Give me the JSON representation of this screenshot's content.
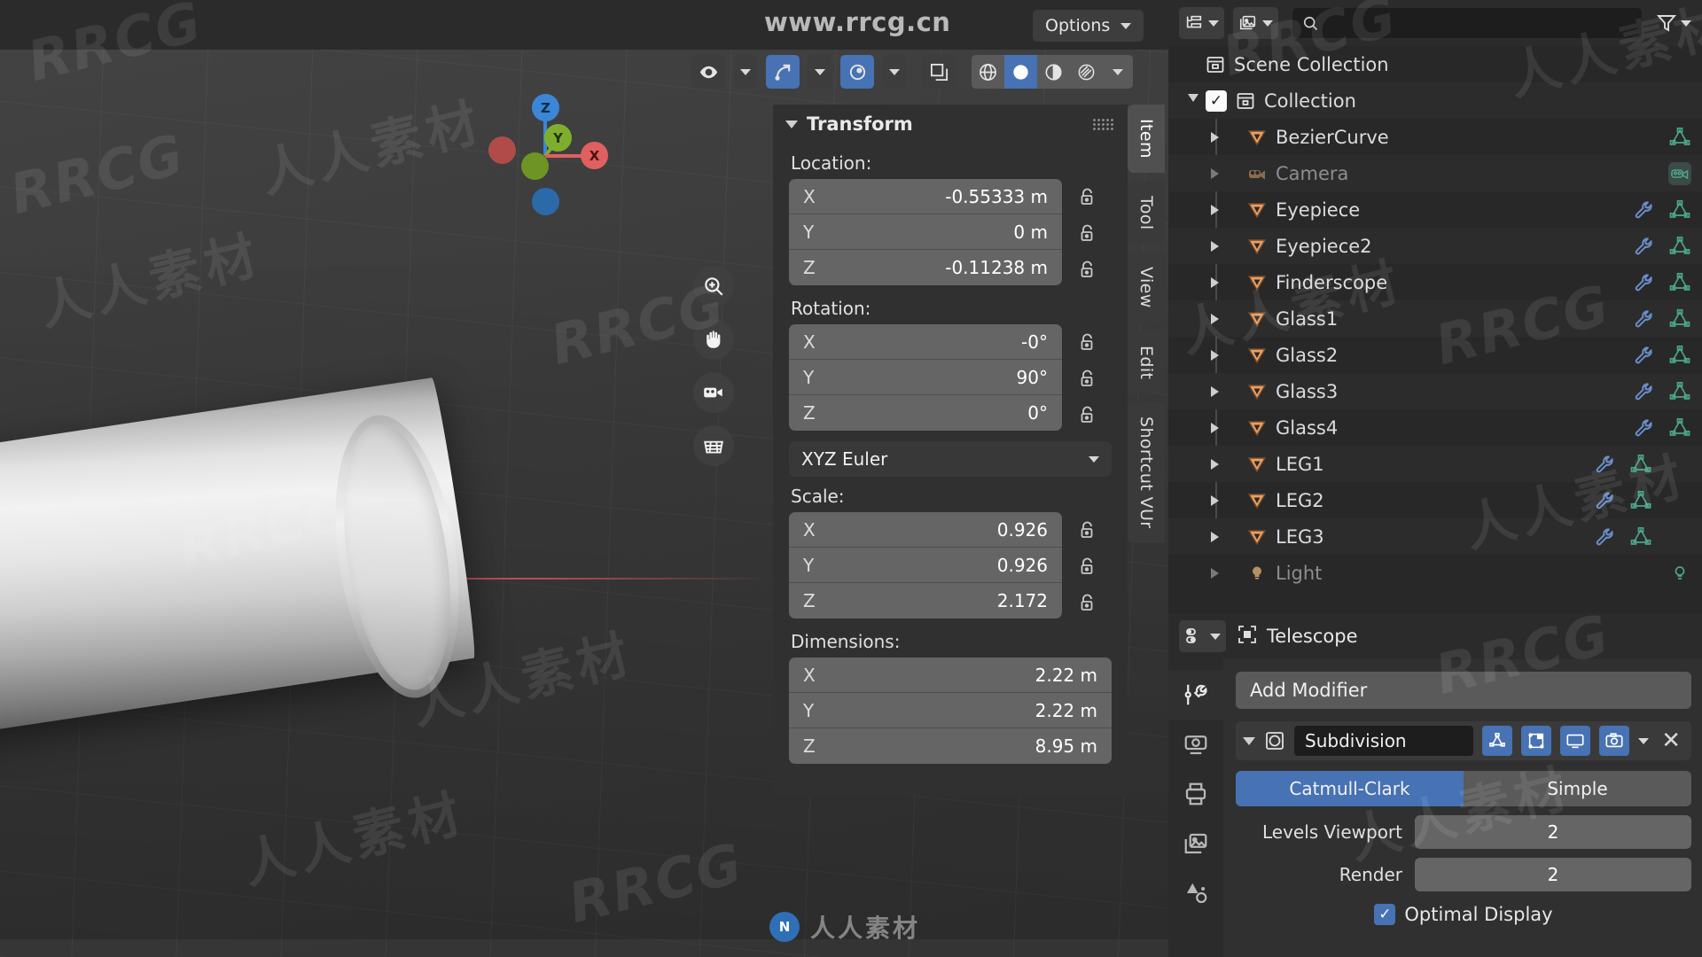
{
  "viewport": {
    "watermark_url": "www.rrcg.cn",
    "options_label": "Options",
    "header_icons": [
      "visibility-icon",
      "snap-magnet-icon",
      "proportional-edit-icon",
      "overlays-icon",
      "xray-icon",
      "wireframe-shading-icon",
      "solid-shading-icon",
      "material-shading-icon",
      "rendered-shading-icon"
    ],
    "gizmo_axes": {
      "x": "X",
      "y": "Y",
      "z": "Z"
    },
    "nav_tools": [
      "zoom-icon",
      "pan-icon",
      "camera-icon",
      "orthographic-icon"
    ]
  },
  "sidebar": {
    "panel_title": "Transform",
    "tabs": [
      {
        "label": "Item",
        "active": true
      },
      {
        "label": "Tool",
        "active": false
      },
      {
        "label": "View",
        "active": false
      },
      {
        "label": "Edit",
        "active": false
      },
      {
        "label": "Shortcut VUr",
        "active": false
      }
    ],
    "location": {
      "label": "Location:",
      "rows": [
        {
          "axis": "X",
          "value": "-0.55333 m"
        },
        {
          "axis": "Y",
          "value": "0 m"
        },
        {
          "axis": "Z",
          "value": "-0.11238 m"
        }
      ]
    },
    "rotation": {
      "label": "Rotation:",
      "rows": [
        {
          "axis": "X",
          "value": "-0°"
        },
        {
          "axis": "Y",
          "value": "90°"
        },
        {
          "axis": "Z",
          "value": "0°"
        }
      ],
      "mode": "XYZ Euler"
    },
    "scale": {
      "label": "Scale:",
      "rows": [
        {
          "axis": "X",
          "value": "0.926"
        },
        {
          "axis": "Y",
          "value": "0.926"
        },
        {
          "axis": "Z",
          "value": "2.172"
        }
      ]
    },
    "dimensions": {
      "label": "Dimensions:",
      "rows": [
        {
          "axis": "X",
          "value": "2.22 m"
        },
        {
          "axis": "Y",
          "value": "2.22 m"
        },
        {
          "axis": "Z",
          "value": "8.95 m"
        }
      ]
    }
  },
  "outliner": {
    "display_mode_icon": "outliner-display-mode-icon",
    "filter_id_icon": "outliner-id-type-icon",
    "search_placeholder": "",
    "filter_icon": "funnel-filter-icon",
    "root": "Scene Collection",
    "collection": "Collection",
    "items": [
      {
        "name": "BezierCurve",
        "type": "mesh",
        "dim": false,
        "has_modifier": false,
        "has_data": true
      },
      {
        "name": "Camera",
        "type": "camera",
        "dim": true,
        "has_modifier": false,
        "has_data": false
      },
      {
        "name": "Eyepiece",
        "type": "mesh",
        "dim": false,
        "has_modifier": true,
        "has_data": true
      },
      {
        "name": "Eyepiece2",
        "type": "mesh",
        "dim": false,
        "has_modifier": true,
        "has_data": true
      },
      {
        "name": "Finderscope",
        "type": "mesh",
        "dim": false,
        "has_modifier": true,
        "has_data": true
      },
      {
        "name": "Glass1",
        "type": "mesh",
        "dim": false,
        "has_modifier": true,
        "has_data": true
      },
      {
        "name": "Glass2",
        "type": "mesh",
        "dim": false,
        "has_modifier": true,
        "has_data": true
      },
      {
        "name": "Glass3",
        "type": "mesh",
        "dim": false,
        "has_modifier": true,
        "has_data": true
      },
      {
        "name": "Glass4",
        "type": "mesh",
        "dim": false,
        "has_modifier": true,
        "has_data": true
      },
      {
        "name": "LEG1",
        "type": "mesh",
        "dim": false,
        "has_modifier": true,
        "has_data": true
      },
      {
        "name": "LEG2",
        "type": "mesh",
        "dim": false,
        "has_modifier": true,
        "has_data": true
      },
      {
        "name": "LEG3",
        "type": "mesh",
        "dim": false,
        "has_modifier": true,
        "has_data": true
      },
      {
        "name": "Light",
        "type": "light",
        "dim": true,
        "has_modifier": false,
        "has_data": true
      }
    ]
  },
  "properties": {
    "object_name": "Telescope",
    "add_modifier_label": "Add Modifier",
    "modifier": {
      "name": "Subdivision",
      "toggles": [
        "edit-mode-display-icon",
        "cage-display-icon",
        "realtime-display-icon",
        "render-display-icon"
      ],
      "subdivision_type": {
        "options": [
          "Catmull-Clark",
          "Simple"
        ],
        "selected": "Catmull-Clark"
      },
      "levels_viewport_label": "Levels Viewport",
      "levels_viewport_value": "2",
      "render_label": "Render",
      "render_value": "2",
      "optimal_display_label": "Optimal Display",
      "optimal_display_checked": true
    },
    "tabs": [
      "tool-icon",
      "render-icon",
      "output-icon",
      "view-layer-icon",
      "scene-icon"
    ]
  },
  "watermarks": {
    "cn": "人人素材",
    "en": "RRCG",
    "badge": "人人素材",
    "badge_mark": "N"
  },
  "colors": {
    "accent_blue": "#4772b3",
    "panel_bg": "#303030",
    "field_bg": "#656565",
    "mesh_orange": "#e8a064",
    "data_green": "#4aa58a"
  }
}
